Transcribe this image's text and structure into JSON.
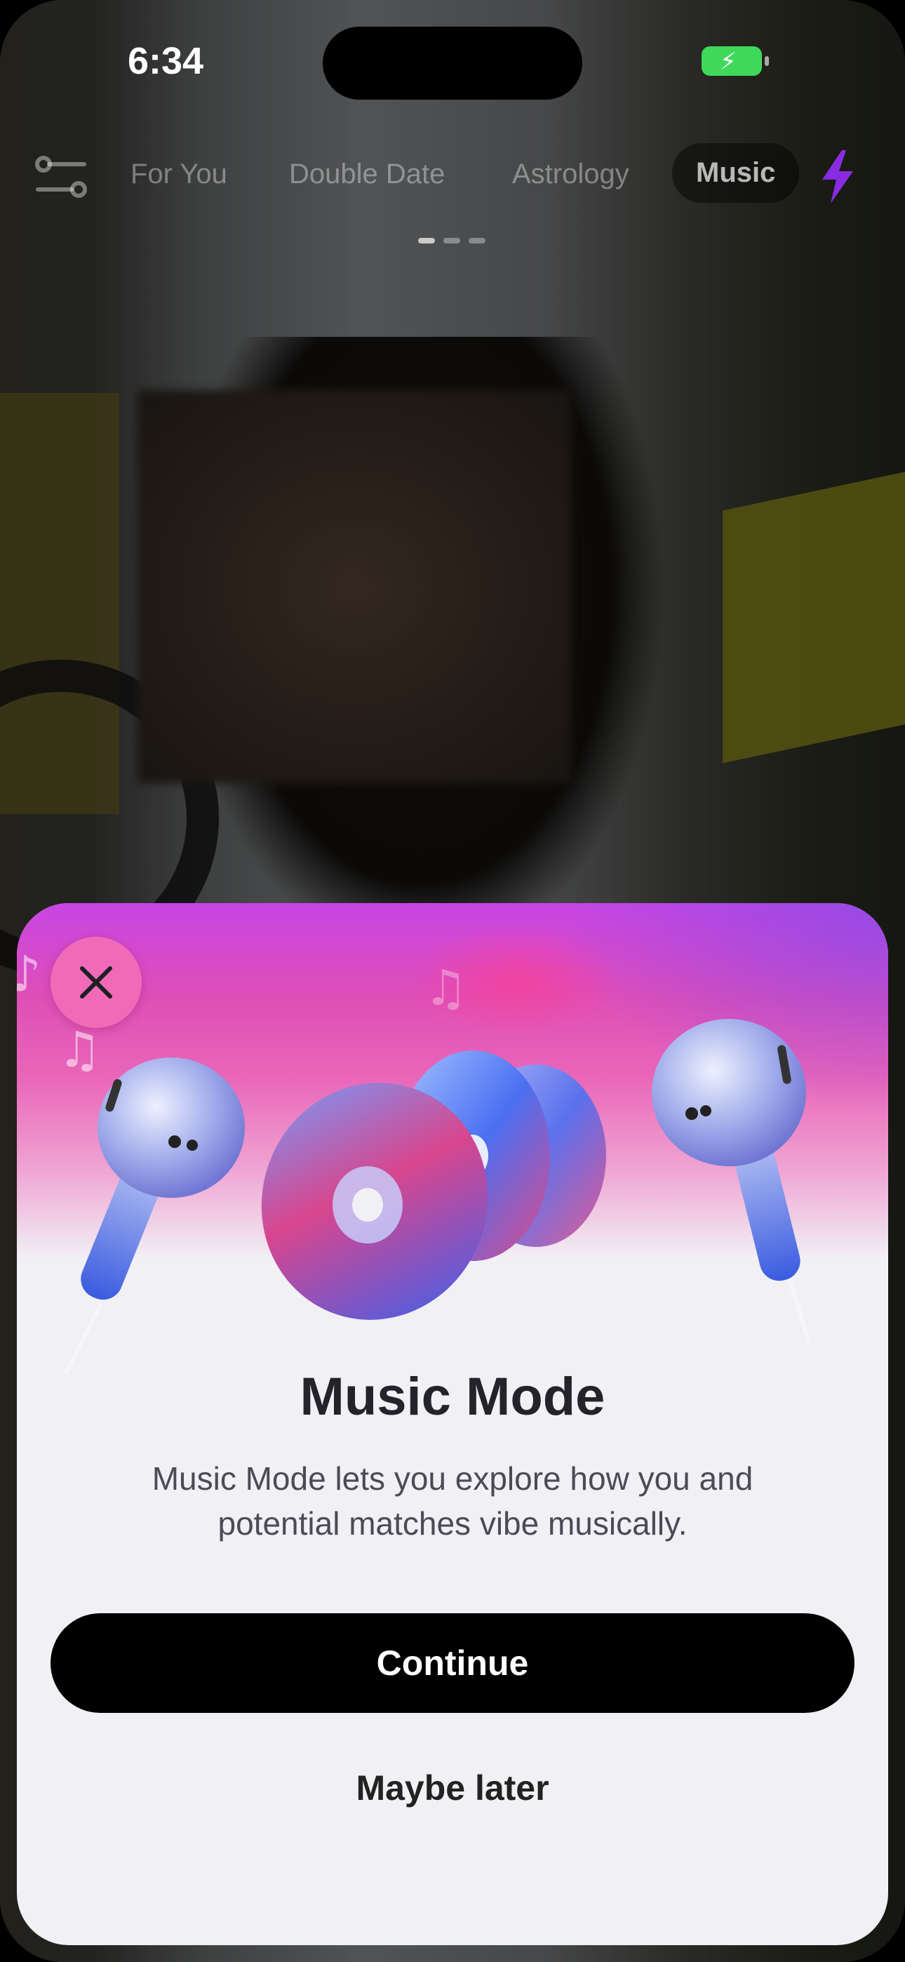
{
  "status_bar": {
    "time": "6:34"
  },
  "nav": {
    "tabs": [
      {
        "label": "For You"
      },
      {
        "label": "Double Date"
      },
      {
        "label": "Astrology"
      },
      {
        "label": "Music"
      }
    ],
    "active_tab": "Music"
  },
  "modal": {
    "title": "Music Mode",
    "description": "Music Mode lets you explore how you and potential matches vibe musically.",
    "continue_label": "Continue",
    "later_label": "Maybe later"
  },
  "colors": {
    "accent_pink": "#f06ab8",
    "accent_purple": "#8a2be2",
    "battery_green": "#3fd95a"
  },
  "icons": [
    "filter-icon",
    "lightning-bolt-icon",
    "close-icon",
    "music-note-icon",
    "earbud-icon",
    "cd-disc-icon",
    "battery-charging-icon"
  ]
}
